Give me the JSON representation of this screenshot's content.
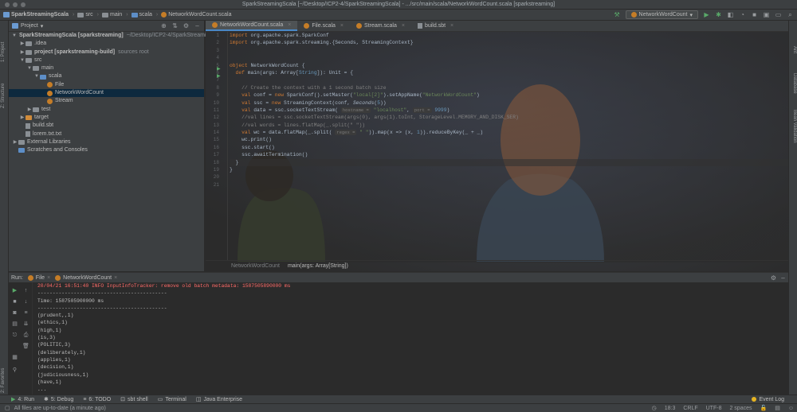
{
  "window": {
    "title": "SparkStreamingScala [~/Desktop/ICP2-4/SparkStreamingScala] - .../src/main/scala/NetworkWordCount.scala [sparkstreaming]"
  },
  "navbar": {
    "crumbs": [
      "SparkStreamingScala",
      "src",
      "main",
      "scala",
      "NetworkWordCount.scala"
    ],
    "run_config": "NetworkWordCount"
  },
  "left_stripe": {
    "tabs": [
      "1: Project",
      "Z: Structure",
      "2: Favorites"
    ]
  },
  "right_stripe": {
    "tabs": [
      "Ant",
      "Database",
      "Bean Validation"
    ]
  },
  "project": {
    "header": "Project",
    "tree": [
      {
        "depth": 0,
        "arrow": "▼",
        "icon": "project-icon",
        "label": "SparkStreamingScala [sparkstreaming]",
        "hint": "~/Desktop/ICP2-4/SparkStreami",
        "bold": true
      },
      {
        "depth": 1,
        "arrow": "▶",
        "icon": "folder-icon",
        "label": ".idea",
        "hint": ""
      },
      {
        "depth": 1,
        "arrow": "▶",
        "icon": "folder-icon",
        "label": "project [sparkstreaming-build]",
        "hint": "sources root",
        "bold": true
      },
      {
        "depth": 1,
        "arrow": "▼",
        "icon": "folder-icon",
        "label": "src",
        "hint": ""
      },
      {
        "depth": 2,
        "arrow": "▼",
        "icon": "folder-icon",
        "label": "main",
        "hint": ""
      },
      {
        "depth": 3,
        "arrow": "▼",
        "icon": "folder-blue-icon",
        "label": "scala",
        "hint": ""
      },
      {
        "depth": 4,
        "arrow": "",
        "icon": "scala-object-icon",
        "label": "File",
        "hint": ""
      },
      {
        "depth": 4,
        "arrow": "",
        "icon": "scala-object-icon",
        "label": "NetworkWordCount",
        "hint": "",
        "selected": true
      },
      {
        "depth": 4,
        "arrow": "",
        "icon": "scala-object-icon",
        "label": "Stream",
        "hint": ""
      },
      {
        "depth": 2,
        "arrow": "▶",
        "icon": "folder-icon",
        "label": "test",
        "hint": ""
      },
      {
        "depth": 1,
        "arrow": "▶",
        "icon": "folder-orange-icon",
        "label": "target",
        "hint": ""
      },
      {
        "depth": 1,
        "arrow": "",
        "icon": "sbt-file-icon",
        "label": "build.sbt",
        "hint": ""
      },
      {
        "depth": 1,
        "arrow": "",
        "icon": "text-file-icon",
        "label": "lorem.txt.txt",
        "hint": ""
      },
      {
        "depth": 0,
        "arrow": "▶",
        "icon": "library-icon",
        "label": "External Libraries",
        "hint": ""
      },
      {
        "depth": 0,
        "arrow": "",
        "icon": "scratch-icon",
        "label": "Scratches and Consoles",
        "hint": ""
      }
    ]
  },
  "editor": {
    "tabs": [
      {
        "label": "NetworkWordCount.scala",
        "active": true
      },
      {
        "label": "File.scala",
        "active": false
      },
      {
        "label": "Stream.scala",
        "active": false
      },
      {
        "label": "build.sbt",
        "active": false
      }
    ],
    "line_numbers": [
      "1",
      "2",
      "3",
      "4",
      "5",
      "6",
      "7",
      "8",
      "9",
      "10",
      "11",
      "12",
      "13",
      "14",
      "15",
      "16",
      "17",
      "18",
      "19",
      "20",
      "21"
    ],
    "code": {
      "l1_kw": "import ",
      "l1_rest": "org.apache.spark.SparkConf",
      "l2_kw": "import ",
      "l2_rest": "org.apache.spark.streaming.{Seconds, StreamingContext}",
      "l5_kw": "object ",
      "l5_rest": "NetworkWordCount {",
      "l6_kw": "  def ",
      "l6_a": "main(args: Array[",
      "l6_type": "String",
      "l6_b": "]): Unit = {",
      "l8": "    // Create the context with a 1 second batch size",
      "l9_kw": "    val ",
      "l9_a": "conf = ",
      "l9_kw2": "new ",
      "l9_b": "SparkConf().setMaster(",
      "l9_s1": "\"local[2]\"",
      "l9_c": ").setAppName(",
      "l9_s2": "\"NetworkWordCount\"",
      "l9_d": ")",
      "l10_kw": "    val ",
      "l10_a": "ssc = ",
      "l10_kw2": "new ",
      "l10_b": "StreamingContext(conf, ",
      "l10_it": "Seconds",
      "l10_c": "(",
      "l10_n": "5",
      "l10_d": "))",
      "l11_kw": "    val ",
      "l11_a": "data = ssc.socketTextStream( ",
      "l11_h1": "hostname =",
      "l11_s": " \"localhost\"",
      "l11_b": ", ",
      "l11_h2": "port =",
      "l11_n": " 9999",
      "l11_c": ")",
      "l12": "    //val lines = ssc.socketTextStream(args(0), args(1).toInt, StorageLevel.MEMORY_AND_DISK_SER)",
      "l13": "    //val words = lines.flatMap(_.split(\" \"))",
      "l14_kw": "    val ",
      "l14_a": "wc = data.flatMap(_.split( ",
      "l14_h": "regex =",
      "l14_s": " \" \"",
      "l14_b": ")).map(x => (x, ",
      "l14_n": "1",
      "l14_c": ")).reduceByKey(_ + _)",
      "l15": "    wc.print()",
      "l16": "    ssc.start()",
      "l17": "    ssc.awaitTermination()",
      "l18": "  }",
      "l19": "}"
    },
    "crumbs": [
      "NetworkWordCount",
      "main(args: Array[String])"
    ]
  },
  "run": {
    "label": "Run:",
    "tabs": [
      "File",
      "NetworkWordCount"
    ],
    "console": [
      {
        "text": "20/04/21 16:51:40 INFO InputInfoTracker: remove old batch metadata: 1587505890000 ms",
        "err": true
      },
      {
        "text": "-------------------------------------------",
        "err": false
      },
      {
        "text": "Time: 1587505900000 ms",
        "err": false
      },
      {
        "text": "-------------------------------------------",
        "err": false
      },
      {
        "text": "(prudent,,1)",
        "err": false
      },
      {
        "text": "(ethics,1)",
        "err": false
      },
      {
        "text": "(high,1)",
        "err": false
      },
      {
        "text": "(is,3)",
        "err": false
      },
      {
        "text": "(POLITIC,3)",
        "err": false
      },
      {
        "text": "(deliberately,1)",
        "err": false
      },
      {
        "text": "(applies,1)",
        "err": false
      },
      {
        "text": "(decision,1)",
        "err": false
      },
      {
        "text": "(judiciousness,1)",
        "err": false
      },
      {
        "text": "(have,1)",
        "err": false
      },
      {
        "text": "...",
        "err": false
      }
    ]
  },
  "tool_tabs": [
    "4: Run",
    "5: Debug",
    "6: TODO",
    "sbt shell",
    "Terminal",
    "Java Enterprise"
  ],
  "event_log": "Event Log",
  "status": {
    "message": "All files are up-to-date (a minute ago)",
    "position": "18:3",
    "line_sep": "CRLF",
    "encoding": "UTF-8",
    "indent": "2 spaces"
  }
}
